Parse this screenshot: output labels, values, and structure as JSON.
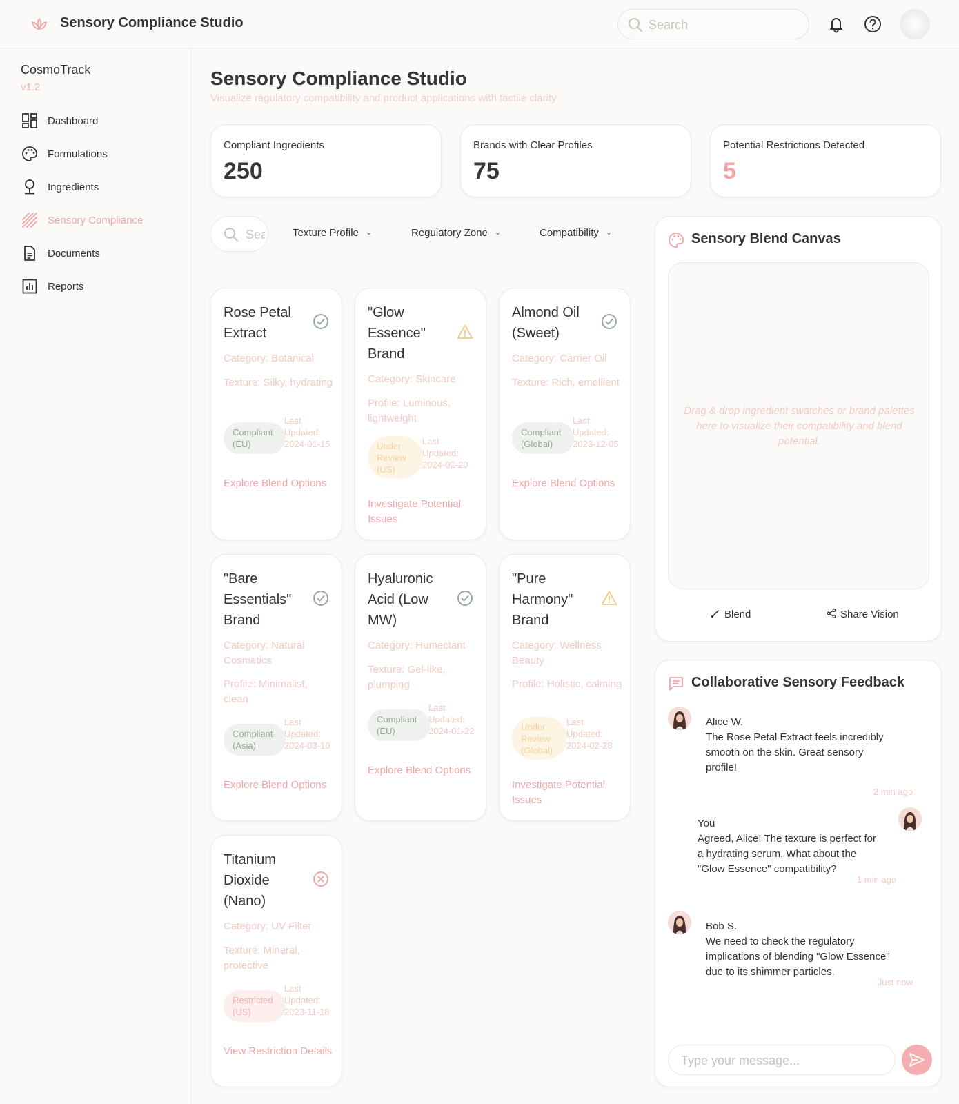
{
  "header": {
    "app_title": "Sensory Compliance Studio",
    "search_placeholder": "Search",
    "icons": [
      "lotus-logo-icon",
      "bell-icon",
      "help-icon",
      "user-avatar"
    ]
  },
  "sidebar": {
    "app_name": "CosmoTrack",
    "version": "v1.2",
    "items": [
      {
        "label": "Dashboard",
        "icon": "dashboard-icon",
        "active": false
      },
      {
        "label": "Formulations",
        "icon": "palette-icon",
        "active": false
      },
      {
        "label": "Ingredients",
        "icon": "tree-icon",
        "active": false
      },
      {
        "label": "Sensory Compliance",
        "icon": "hatch-icon",
        "active": true
      },
      {
        "label": "Documents",
        "icon": "document-icon",
        "active": false
      },
      {
        "label": "Reports",
        "icon": "report-icon",
        "active": false
      }
    ]
  },
  "main": {
    "title": "Sensory Compliance Studio",
    "subtitle": "Visualize regulatory compatibility and product applications with tactile clarity",
    "stats": [
      {
        "label": "Compliant Ingredients",
        "value": "250"
      },
      {
        "label": "Brands with Clear Profiles",
        "value": "75"
      },
      {
        "label": "Potential Restrictions Detected",
        "value": "5"
      }
    ],
    "filters": {
      "search_placeholder": "Search",
      "texture": "Texture Profile",
      "zone": "Regulatory Zone",
      "compat": "Compatibility"
    },
    "cards": [
      {
        "name": "Rose Petal Extract",
        "status": "check-circle-icon",
        "category": "Category: Botanical",
        "profile": "Texture: Silky, hydrating",
        "badge": "Compliant (EU)",
        "badge_type": "ok",
        "updated": "Last Updated: 2024-01-15",
        "action": "Explore Blend Options"
      },
      {
        "name": "\"Glow Essence\" Brand",
        "status": "warning-icon",
        "category": "Category: Skincare",
        "profile": "Profile: Luminous, lightweight",
        "badge": "Under Review (US)",
        "badge_type": "review",
        "updated": "Last Updated: 2024-02-20",
        "action": "Investigate Potential Issues"
      },
      {
        "name": "Almond Oil (Sweet)",
        "status": "check-circle-icon",
        "category": "Category: Carrier Oil",
        "profile": "Texture: Rich, emollient",
        "badge": "Compliant (Global)",
        "badge_type": "ok",
        "updated": "Last Updated: 2023-12-05",
        "action": "Explore Blend Options"
      },
      {
        "name": "\"Bare Essentials\" Brand",
        "status": "check-circle-icon",
        "category": "Category: Natural Cosmetics",
        "profile": "Profile: Minimalist, clean",
        "badge": "Compliant (Asia)",
        "badge_type": "ok",
        "updated": "Last Updated: 2024-03-10",
        "action": "Explore Blend Options"
      },
      {
        "name": "Hyaluronic Acid (Low MW)",
        "status": "check-circle-icon",
        "category": "Category: Humectant",
        "profile": "Texture: Gel-like, plumping",
        "badge": "Compliant (EU)",
        "badge_type": "ok",
        "updated": "Last Updated: 2024-01-22",
        "action": "Explore Blend Options"
      },
      {
        "name": "\"Pure Harmony\" Brand",
        "status": "warning-icon",
        "category": "Category: Wellness Beauty",
        "profile": "Profile: Holistic, calming",
        "badge": "Under Review (Global)",
        "badge_type": "review",
        "updated": "Last Updated: 2024-02-28",
        "action": "Investigate Potential Issues"
      },
      {
        "name": "Titanium Dioxide (Nano)",
        "status": "x-circle-icon",
        "category": "Category: UV Filter",
        "profile": "Texture: Mineral, protective",
        "badge": "Restricted (US)",
        "badge_type": "bad",
        "updated": "Last Updated: 2023-11-18",
        "action": "View Restriction Details"
      }
    ]
  },
  "canvas": {
    "title": "Sensory Blend Canvas",
    "hint": "Drag & drop ingredient swatches or brand palettes here to visualize their compatibility and blend potential.",
    "blend_label": "Blend",
    "share_label": "Share Vision"
  },
  "feedback": {
    "title": "Collaborative Sensory Feedback",
    "messages": [
      {
        "author": "Alice W.",
        "text": "The Rose Petal Extract feels incredibly smooth on the skin. Great sensory profile!",
        "time": "2 min ago"
      },
      {
        "author": "You",
        "text": "Agreed, Alice! The texture is perfect for a hydrating serum. What about the \"Glow Essence\" compatibility?",
        "time": "1 min ago"
      },
      {
        "author": "Bob S.",
        "text": "We need to check the regulatory implications of blending \"Glow Essence\" due to its shimmer particles.",
        "time": "Just now"
      }
    ],
    "input_placeholder": "Type your message..."
  },
  "colors": {
    "accent": "#f0a6a8",
    "muted_text": "#f3cbc3",
    "ok_green": "#9aaa9a",
    "warn_amber": "#f3cf8f",
    "error_red": "#f0a6a8"
  }
}
